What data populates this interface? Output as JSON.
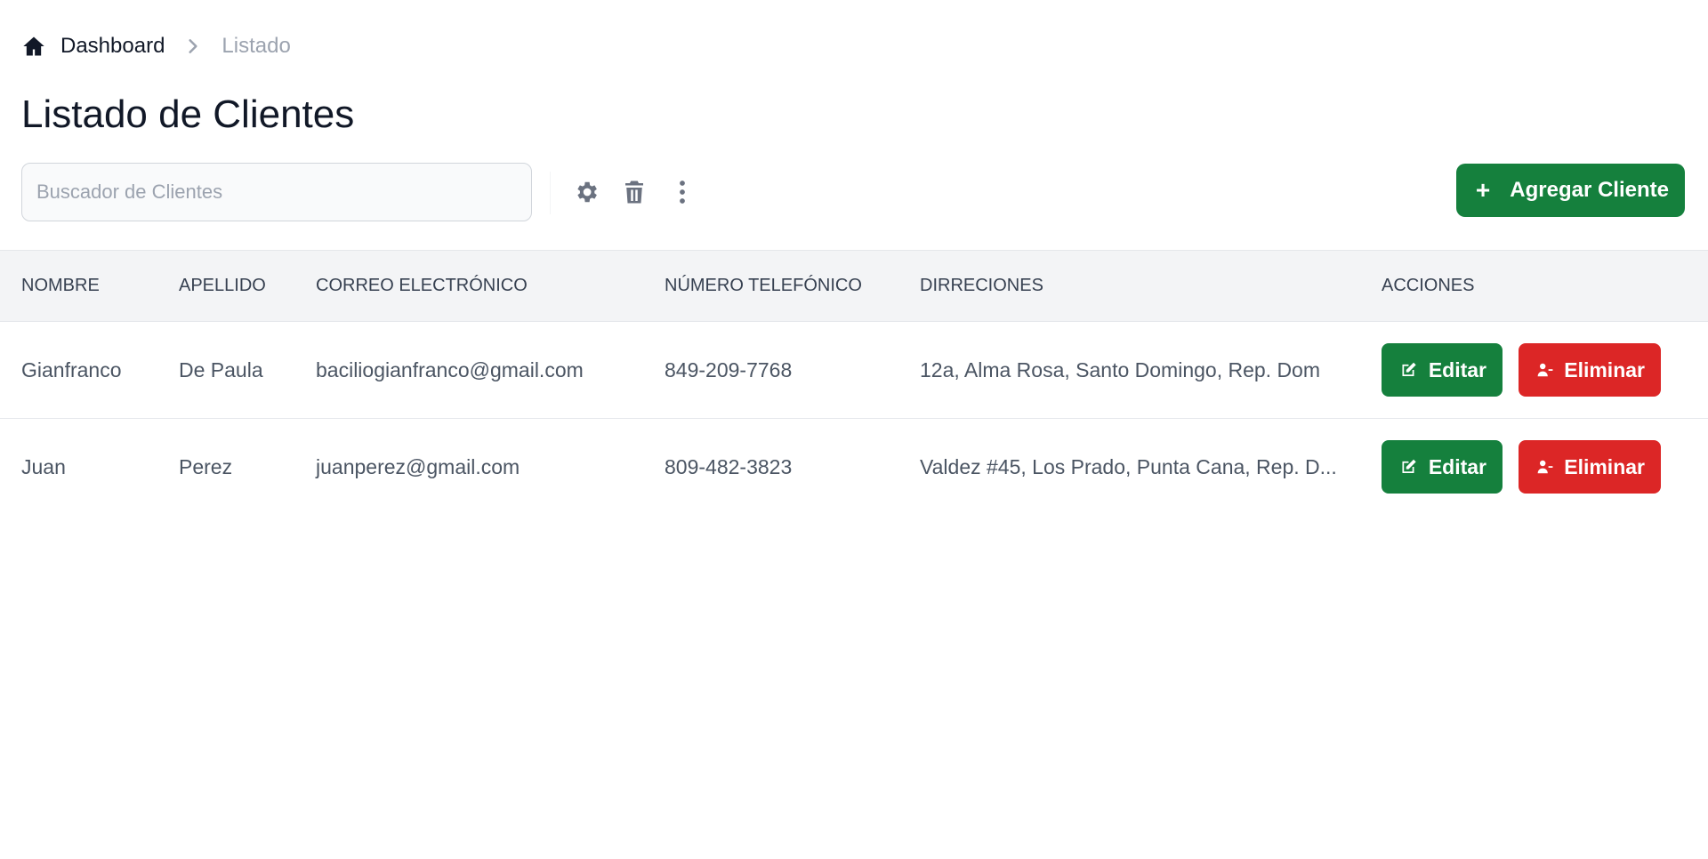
{
  "breadcrumb": {
    "home_label": "Dashboard",
    "current_label": "Listado"
  },
  "page_title": "Listado de Clientes",
  "toolbar": {
    "search_placeholder": "Buscador de Clientes",
    "add_label": "Agregar Cliente",
    "icons": [
      "gear-icon",
      "trash-icon",
      "more-vertical-icon"
    ]
  },
  "table": {
    "headers": {
      "nombre": "NOMBRE",
      "apellido": "APELLIDO",
      "correo": "CORREO ELECTRÓNICO",
      "telefono": "NÚMERO TELEFÓNICO",
      "direcciones": "DIRRECIONES",
      "acciones": "ACCIONES"
    },
    "rows": [
      {
        "nombre": "Gianfranco",
        "apellido": "De Paula",
        "correo": "baciliogianfranco@gmail.com",
        "telefono": "849-209-7768",
        "direccion": "12a, Alma Rosa, Santo Domingo, Rep. Dom"
      },
      {
        "nombre": "Juan",
        "apellido": "Perez",
        "correo": "juanperez@gmail.com",
        "telefono": "809-482-3823",
        "direccion": "Valdez #45, Los Prado, Punta Cana, Rep. D..."
      }
    ],
    "edit_label": "Editar",
    "delete_label": "Eliminar"
  },
  "colors": {
    "primary_green": "#15803d",
    "danger_red": "#dc2626",
    "header_bg": "#f3f4f6"
  }
}
